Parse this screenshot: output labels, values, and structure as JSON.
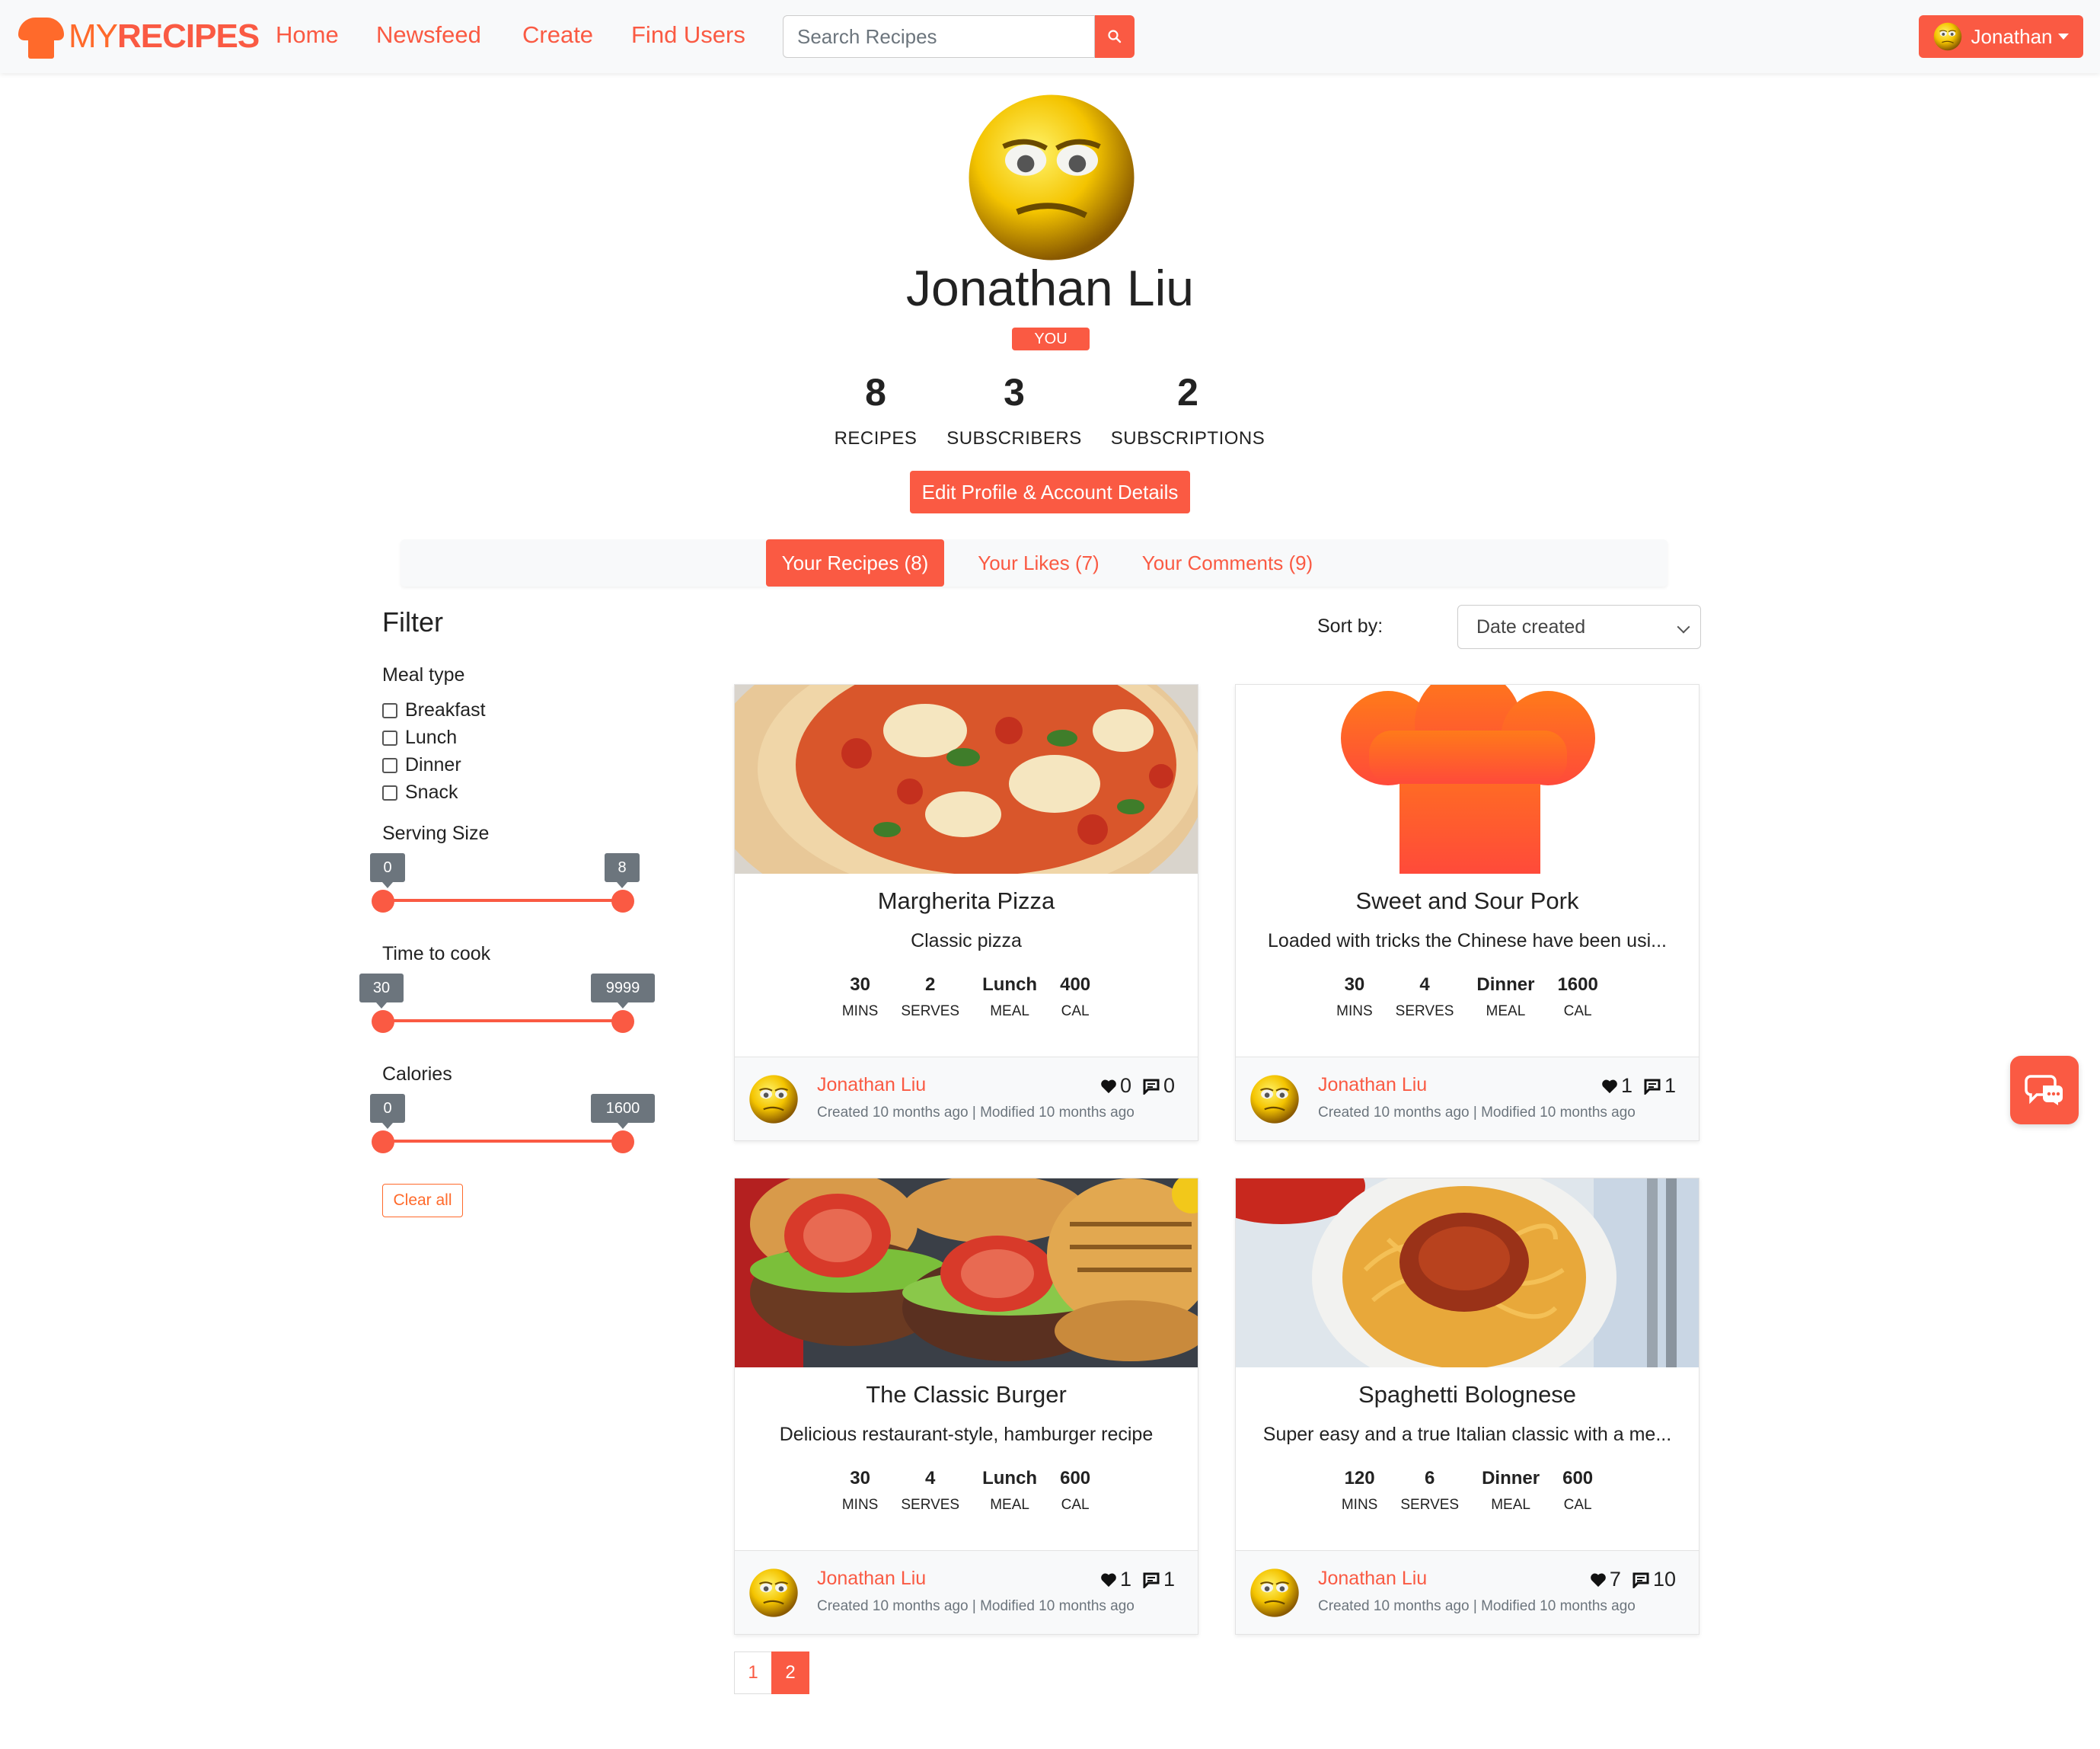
{
  "navbar": {
    "logo_my": "MY",
    "logo_recipes": "RECIPES",
    "links": [
      "Home",
      "Newsfeed",
      "Create",
      "Find Users"
    ],
    "search_placeholder": "Search Recipes",
    "user_name": "Jonathan"
  },
  "profile": {
    "name": "Jonathan Liu",
    "badge": "YOU",
    "stats": [
      {
        "value": "8",
        "label": "RECIPES"
      },
      {
        "value": "3",
        "label": "SUBSCRIBERS"
      },
      {
        "value": "2",
        "label": "SUBSCRIPTIONS"
      }
    ],
    "edit_button": "Edit Profile & Account Details"
  },
  "tabs": [
    {
      "label": "Your Recipes (8)",
      "active": true
    },
    {
      "label": "Your Likes (7)",
      "active": false
    },
    {
      "label": "Your Comments (9)",
      "active": false
    }
  ],
  "filter": {
    "title": "Filter",
    "meal_type_label": "Meal type",
    "meal_types": [
      "Breakfast",
      "Lunch",
      "Dinner",
      "Snack"
    ],
    "serving_label": "Serving Size",
    "serving_min": "0",
    "serving_max": "8",
    "time_label": "Time to cook",
    "time_min": "30",
    "time_max": "9999",
    "calories_label": "Calories",
    "calories_min": "0",
    "calories_max": "1600",
    "clear_button": "Clear all"
  },
  "sort": {
    "label": "Sort by:",
    "selected": "Date created"
  },
  "recipes": [
    {
      "title": "Margherita Pizza",
      "description": "Classic pizza",
      "mins": "30",
      "serves": "2",
      "meal": "Lunch",
      "cal": "400",
      "author": "Jonathan Liu",
      "created": "Created 10 months ago",
      "modified": "Modified 10 months ago",
      "likes": "0",
      "comments": "0"
    },
    {
      "title": "Sweet and Sour Pork",
      "description": "Loaded with tricks the Chinese have been usi...",
      "mins": "30",
      "serves": "4",
      "meal": "Dinner",
      "cal": "1600",
      "author": "Jonathan Liu",
      "created": "Created 10 months ago",
      "modified": "Modified 10 months ago",
      "likes": "1",
      "comments": "1"
    },
    {
      "title": "The Classic Burger",
      "description": "Delicious restaurant-style, hamburger recipe",
      "mins": "30",
      "serves": "4",
      "meal": "Lunch",
      "cal": "600",
      "author": "Jonathan Liu",
      "created": "Created 10 months ago",
      "modified": "Modified 10 months ago",
      "likes": "1",
      "comments": "1"
    },
    {
      "title": "Spaghetti Bolognese",
      "description": "Super easy and a true Italian classic with a me...",
      "mins": "120",
      "serves": "6",
      "meal": "Dinner",
      "cal": "600",
      "author": "Jonathan Liu",
      "created": "Created 10 months ago",
      "modified": "Modified 10 months ago",
      "likes": "7",
      "comments": "10"
    }
  ],
  "stat_labels": {
    "mins": "MINS",
    "serves": "SERVES",
    "meal": "MEAL",
    "cal": "CAL"
  },
  "date_separator": "|",
  "pagination": [
    "1",
    "2"
  ],
  "colors": {
    "accent": "#fa5a43",
    "accent_orange": "#ff6a2b",
    "tooltip": "#6c757d"
  },
  "icons": [
    "chef-hat-icon",
    "search-icon",
    "caret-down-icon",
    "heart-icon",
    "comment-icon",
    "chat-icon"
  ]
}
